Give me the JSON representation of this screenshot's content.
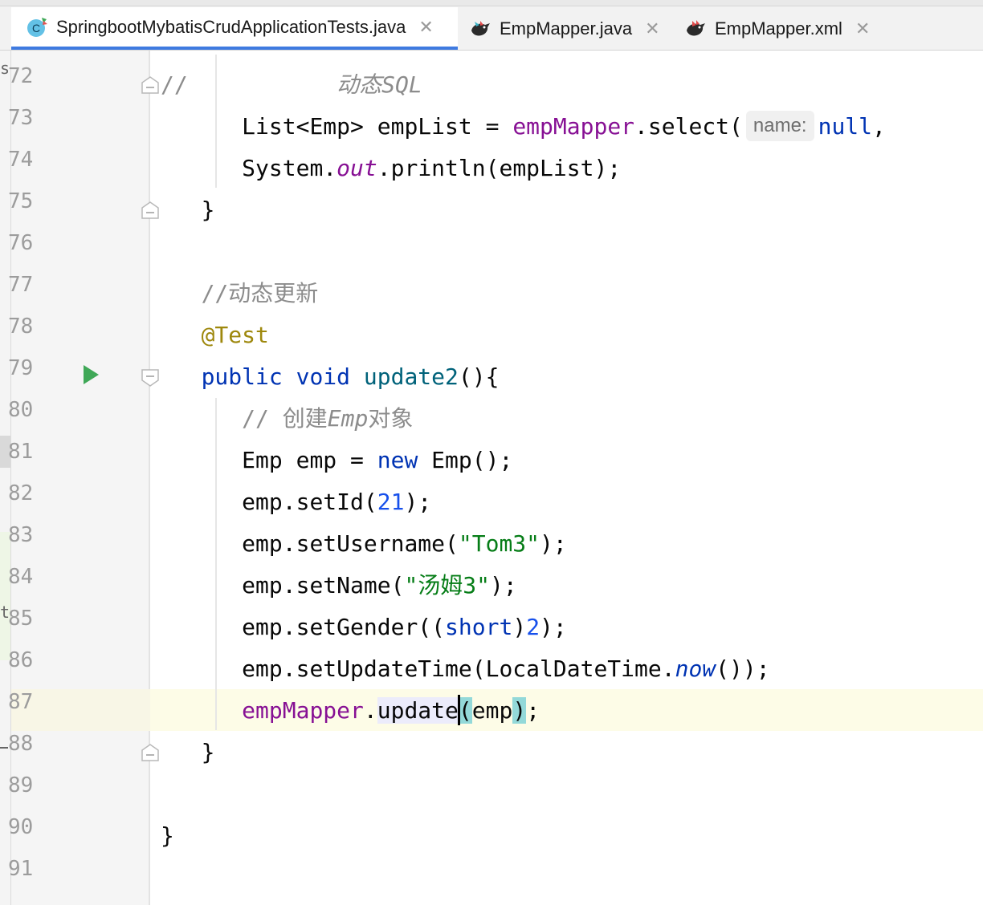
{
  "tabs": [
    {
      "label": "SpringbootMybatisCrudApplicationTests.java",
      "icon": "java-class-icon",
      "active": true
    },
    {
      "label": "EmpMapper.java",
      "icon": "mybatis-bird-icon",
      "active": false
    },
    {
      "label": "EmpMapper.xml",
      "icon": "mybatis-bird-icon",
      "active": false
    }
  ],
  "tab_close_glyph": "✕",
  "left_strip": {
    "fragment_top": "s",
    "fragment_mid": "t:"
  },
  "line_numbers": [
    "72",
    "73",
    "74",
    "75",
    "76",
    "77",
    "78",
    "79",
    "80",
    "81",
    "82",
    "83",
    "84",
    "85",
    "86",
    "87",
    "88",
    "89",
    "90",
    "91"
  ],
  "current_line": "87",
  "code": {
    "l72_a": "//",
    "l72_b": "动态SQL",
    "l73_a": "List<Emp> empList = ",
    "l73_b": "empMapper",
    "l73_c": ".select(",
    "l73_hint": "name:",
    "l73_d": "null",
    "l73_e": ",",
    "l74_a": "System.",
    "l74_b": "out",
    "l74_c": ".println(empList);",
    "l75": "}",
    "l77": "//动态更新",
    "l78": "@Test",
    "l79_a": "public void ",
    "l79_b": "update2",
    "l79_c": "(){",
    "l80_a": "// 创建",
    "l80_b": "Emp",
    "l80_c": "对象",
    "l81_a": "Emp emp = ",
    "l81_b": "new",
    "l81_c": " Emp();",
    "l82_a": "emp.setId(",
    "l82_b": "21",
    "l82_c": ");",
    "l83_a": "emp.setUsername(",
    "l83_b": "\"Tom3\"",
    "l83_c": ");",
    "l84_a": "emp.setName(",
    "l84_b": "\"汤姆3\"",
    "l84_c": ");",
    "l85_a": "emp.setGender((",
    "l85_b": "short",
    "l85_c": ")",
    "l85_d": "2",
    "l85_e": ");",
    "l86_a": "emp.setUpdateTime(LocalDateTime.",
    "l86_b": "now",
    "l86_c": "());",
    "l87_a": "empMapper",
    "l87_b": ".",
    "l87_c": "update",
    "l87_d": "(",
    "l87_e": "emp",
    "l87_f": ")",
    "l87_g": ";",
    "l88": "}",
    "l90": "}"
  },
  "colors": {
    "keyword": "#0033b3",
    "comment": "#8c8c8c",
    "annotation": "#9e880d",
    "method_decl": "#00627a",
    "field": "#871094",
    "string": "#067d17",
    "number": "#1750eb",
    "tab_underline": "#3e7ae0",
    "run_icon": "#3fa857"
  }
}
